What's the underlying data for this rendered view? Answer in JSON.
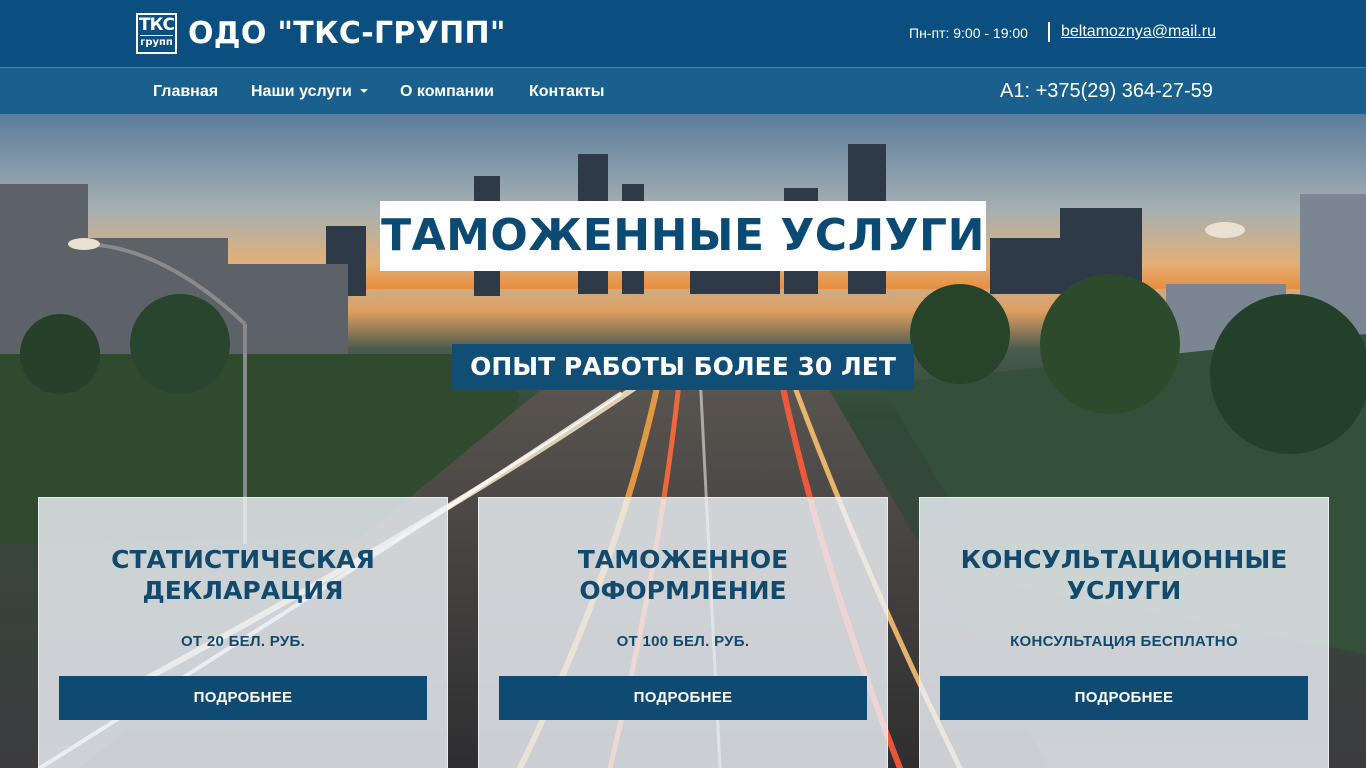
{
  "header": {
    "logo_top": "ТКС",
    "logo_bottom": "групп",
    "brand": "ОДО \"ТКС-ГРУПП\"",
    "hours": "Пн-пт: 9:00 - 19:00",
    "email": "beltamoznya@mail.ru"
  },
  "nav": {
    "items": [
      {
        "label": "Главная"
      },
      {
        "label": "Наши услуги",
        "has_dropdown": true
      },
      {
        "label": "О компании"
      },
      {
        "label": "Контакты"
      }
    ],
    "phone": "A1: +375(29) 364-27-59"
  },
  "hero": {
    "title": "ТАМОЖЕННЫЕ УСЛУГИ",
    "subtitle": "ОПЫТ РАБОТЫ БОЛЕЕ 30 ЛЕТ"
  },
  "cards": [
    {
      "title_line1": "СТАТИСТИЧЕСКАЯ",
      "title_line2": "ДЕКЛАРАЦИЯ",
      "price": "ОТ 20 БЕЛ. РУБ.",
      "button": "ПОДРОБНЕЕ"
    },
    {
      "title_line1": "ТАМОЖЕННОЕ",
      "title_line2": "ОФОРМЛЕНИЕ",
      "price": "ОТ 100 БЕЛ. РУБ.",
      "button": "ПОДРОБНЕЕ"
    },
    {
      "title_line1": "КОНСУЛЬТАЦИОННЫЕ",
      "title_line2": "УСЛУГИ",
      "price": "КОНСУЛЬТАЦИЯ БЕСПЛАТНО",
      "button": "ПОДРОБНЕЕ"
    }
  ],
  "colors": {
    "header_bg": "#0b4f80",
    "nav_bg": "#1a608e",
    "accent_dark": "#0e4a72",
    "text_dark": "#124a6e"
  },
  "icons": {
    "dropdown": "chevron-down-icon"
  }
}
